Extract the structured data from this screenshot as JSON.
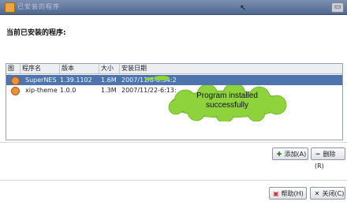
{
  "window": {
    "title": "已安装的程序",
    "close_glyph": "▭"
  },
  "heading": "当前已安装的程序:",
  "table": {
    "columns": [
      "图标",
      "程序名",
      "版本",
      "大小",
      "安装日期"
    ],
    "rows": [
      {
        "icon": "app-icon",
        "name": "SuperNES",
        "version": "1.39.1102",
        "size": "1.6M",
        "date": "2007/11/8-8:34:2",
        "selected": true
      },
      {
        "icon": "app-icon",
        "name": "xip-theme",
        "version": "1.0.0",
        "size": "1.3M",
        "date": "2007/11/22-6:13:",
        "selected": false
      }
    ]
  },
  "callout": {
    "text_line1": "Program installed",
    "text_line2": "successfully",
    "color": "#8ed23c"
  },
  "buttons": {
    "add": "添加(A)",
    "delete": "删除(R)",
    "help": "帮助(H)",
    "close": "关闭(C)"
  },
  "colors": {
    "selection": "#4e74ad",
    "titlebar": "#5b7299"
  }
}
